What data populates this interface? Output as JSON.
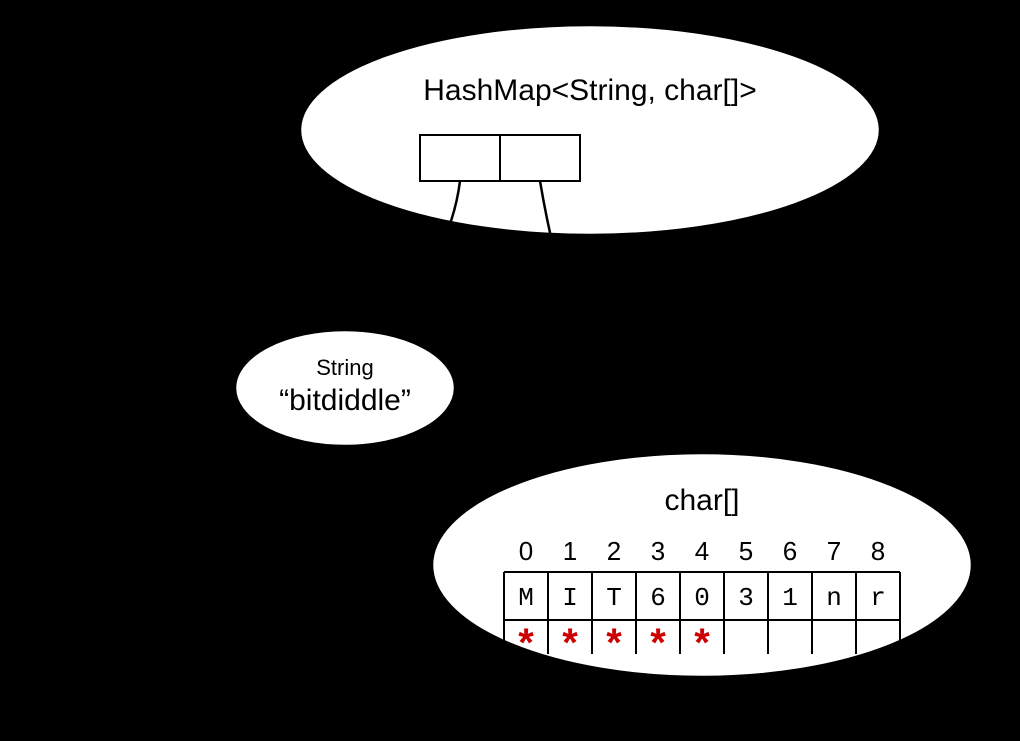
{
  "hashmap": {
    "title": "HashMap<String,  char[]>"
  },
  "string_node": {
    "type_label": "String",
    "value": "“bitdiddle”"
  },
  "char_array": {
    "type_label": "char[]",
    "indices": [
      "0",
      "1",
      "2",
      "3",
      "4",
      "5",
      "6",
      "7",
      "8"
    ],
    "cells": [
      "M",
      "I",
      "T",
      "6",
      "0",
      "3",
      "1",
      "n",
      "r"
    ],
    "asterisk_mark": "*",
    "asterisk_count": 5
  }
}
